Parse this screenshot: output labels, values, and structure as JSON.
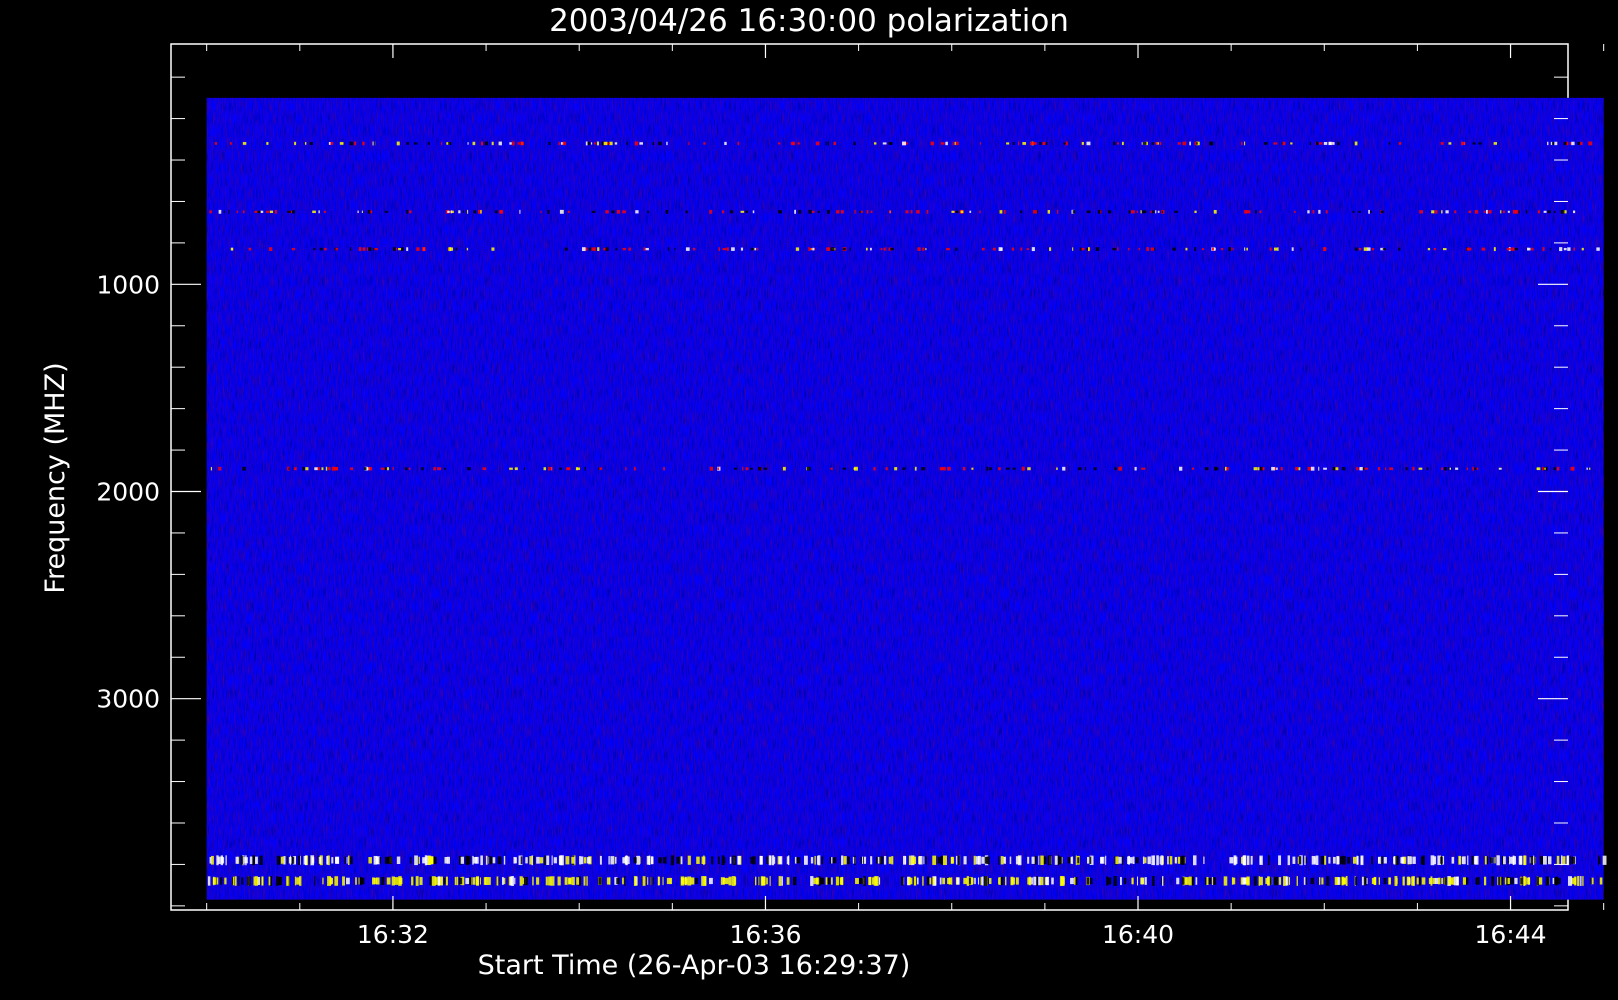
{
  "chart_data": {
    "type": "heatmap",
    "title": "2003/04/26 16:30:00 polarization",
    "xlabel": "Start Time (26-Apr-03 16:29:37)",
    "ylabel": "Frequency (MHZ)",
    "x_ticks": [
      "16:32",
      "16:36",
      "16:40",
      "16:44"
    ],
    "x_tick_minutes": [
      2.383,
      6.383,
      10.383,
      14.383
    ],
    "y_ticks": [
      "1000",
      "2000",
      "3000"
    ],
    "y_tick_values": [
      1000,
      2000,
      3000
    ],
    "xlim_minutes": [
      0,
      15
    ],
    "ylim": [
      4020,
      -160
    ],
    "y_axis_inverted": true,
    "data_extent_minutes": [
      0.383,
      15.383
    ],
    "data_extent_mhz": [
      100,
      3970
    ],
    "grid": false,
    "colormap": {
      "background": "#0000ff",
      "low": "#000000",
      "mid": "#ff0000",
      "high": "#ffffff",
      "accent": "#ffff00"
    },
    "features": [
      {
        "kind": "band",
        "mhz": 320,
        "description_color": "#ff0000"
      },
      {
        "kind": "band",
        "mhz": 650,
        "description_color": "#ff0000"
      },
      {
        "kind": "band",
        "mhz": 830,
        "description_color": "#ff0000"
      },
      {
        "kind": "band",
        "mhz": 1890,
        "description_color": "#ff0000"
      },
      {
        "kind": "band",
        "mhz": 3780,
        "description_color": "#ffffff"
      },
      {
        "kind": "band",
        "mhz": 3880,
        "description_color": "#ffff00"
      }
    ]
  }
}
